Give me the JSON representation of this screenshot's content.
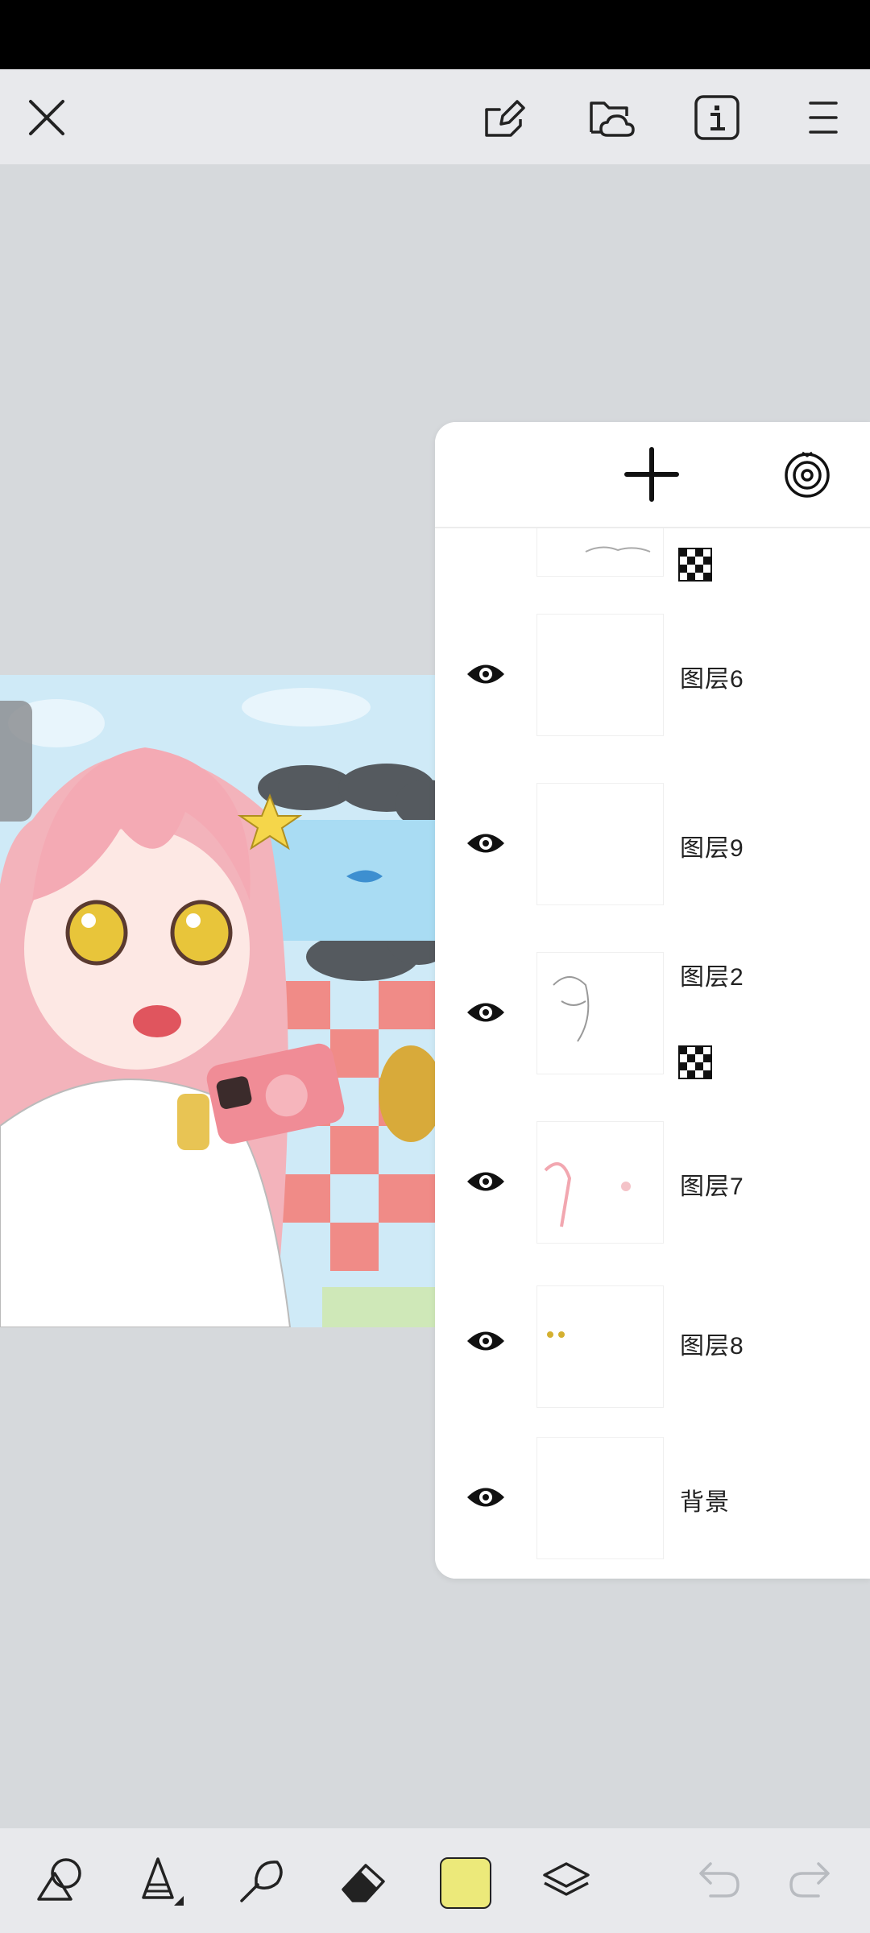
{
  "app": {
    "top_bar": {
      "close": "close-icon",
      "actions": [
        "canvas-edit-icon",
        "cloud-folder-icon",
        "info-icon",
        "menu-icon"
      ]
    },
    "layers_panel": {
      "add": "plus-icon",
      "more": "spiral-icon",
      "layers": [
        {
          "name": "",
          "alpha_locked": true,
          "visible": true
        },
        {
          "name": "图层6",
          "alpha_locked": false,
          "visible": true
        },
        {
          "name": "图层9",
          "alpha_locked": false,
          "visible": true
        },
        {
          "name": "图层2",
          "alpha_locked": true,
          "visible": true
        },
        {
          "name": "图层7",
          "alpha_locked": false,
          "visible": true
        },
        {
          "name": "图层8",
          "alpha_locked": false,
          "visible": true
        },
        {
          "name": "背景",
          "alpha_locked": false,
          "visible": true
        }
      ]
    },
    "bottom_bar": {
      "tools": [
        "shape-tool-icon",
        "pen-tool-icon",
        "smudge-tool-icon",
        "eraser-icon",
        "color-swatch",
        "layers-icon",
        "undo-icon",
        "redo-icon"
      ],
      "current_color": "#ece97a"
    }
  }
}
